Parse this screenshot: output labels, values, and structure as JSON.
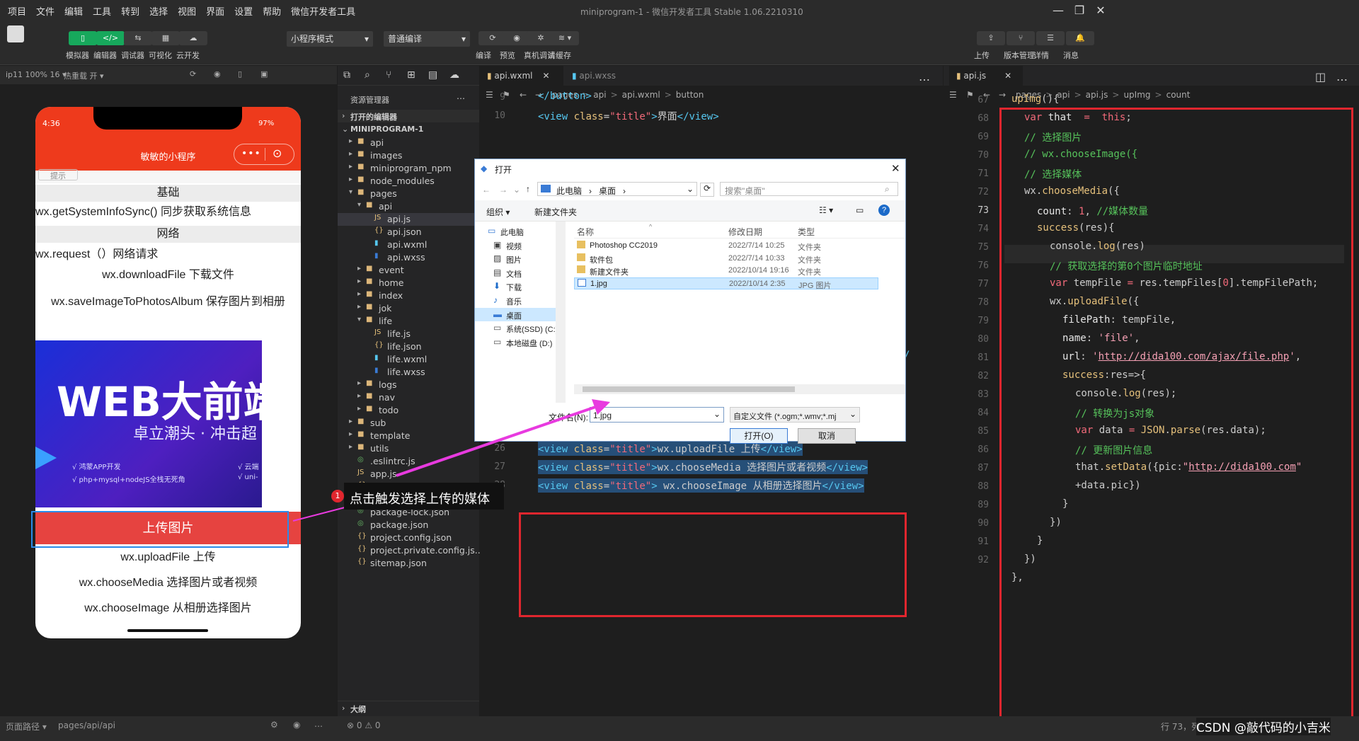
{
  "menubar": {
    "items": [
      "项目",
      "文件",
      "编辑",
      "工具",
      "转到",
      "选择",
      "视图",
      "界面",
      "设置",
      "帮助",
      "微信开发者工具"
    ],
    "window_title": "miniprogram-1 - 微信开发者工具 Stable 1.06.2210310"
  },
  "toolbar": {
    "left_buttons": [
      {
        "label": "模拟器",
        "icon": "phone-icon"
      },
      {
        "label": "编辑器",
        "icon": "code-icon"
      },
      {
        "label": "调试器",
        "icon": "debug-icon"
      },
      {
        "label": "可视化",
        "icon": "layout-icon"
      },
      {
        "label": "云开发",
        "icon": "cloud-icon"
      }
    ],
    "mode_select": "小程序模式",
    "compile_select": "普通编译",
    "mid_buttons": [
      {
        "label": "编译",
        "icon": "refresh-icon"
      },
      {
        "label": "预览",
        "icon": "eye-icon"
      },
      {
        "label": "真机调试",
        "icon": "bug-icon"
      },
      {
        "label": "清缓存",
        "icon": "layers-icon"
      }
    ],
    "right_buttons": [
      {
        "label": "上传",
        "icon": "upload-icon"
      },
      {
        "label": "版本管理",
        "icon": "branch-icon"
      },
      {
        "label": "详情",
        "icon": "menu-icon"
      },
      {
        "label": "消息",
        "icon": "bell-icon"
      }
    ]
  },
  "simulator": {
    "device": "ip11 100% 16 ▾",
    "hotreload": "热重载 开 ▾",
    "status_time": "4:36",
    "battery": "97%",
    "nav_title": "敏敏的小程序",
    "partial_button": "提示",
    "rows": [
      "基础",
      "wx.getSystemInfoSync() 同步获取系统信息",
      "网络",
      "wx.request（）网络请求",
      "wx.downloadFile 下载文件",
      "wx.saveImageToPhotosAlbum 保存图片到相册"
    ],
    "banner": {
      "big": "WEB大前端",
      "sub": "卓立潮头 · 冲击超",
      "b1": "√ 鸿蒙APP开发",
      "b2": "√ php+mysql+nodeJS全栈无死角",
      "b3": "√ 云端",
      "b4": "√ uni-"
    },
    "upload_button": "上传图片",
    "rows2": [
      "wx.uploadFile 上传",
      "wx.chooseMedia 选择图片或者视频",
      "wx.chooseImage 从相册选择图片"
    ]
  },
  "explorer": {
    "title": "资源管理器",
    "open_editors": "打开的编辑器",
    "project": "MINIPROGRAM-1",
    "tree": [
      {
        "name": "api",
        "type": "folder",
        "level": 1
      },
      {
        "name": "images",
        "type": "folder",
        "level": 1
      },
      {
        "name": "miniprogram_npm",
        "type": "folder",
        "level": 1
      },
      {
        "name": "node_modules",
        "type": "folder",
        "level": 1
      },
      {
        "name": "pages",
        "type": "folder-open",
        "level": 1
      },
      {
        "name": "api",
        "type": "folder-open",
        "level": 2
      },
      {
        "name": "api.js",
        "type": "js",
        "level": 3,
        "selected": true
      },
      {
        "name": "api.json",
        "type": "json",
        "level": 3
      },
      {
        "name": "api.wxml",
        "type": "wxml",
        "level": 3
      },
      {
        "name": "api.wxss",
        "type": "wxss",
        "level": 3
      },
      {
        "name": "event",
        "type": "folder",
        "level": 2
      },
      {
        "name": "home",
        "type": "folder",
        "level": 2
      },
      {
        "name": "index",
        "type": "folder",
        "level": 2
      },
      {
        "name": "jok",
        "type": "folder",
        "level": 2
      },
      {
        "name": "life",
        "type": "folder-open",
        "level": 2
      },
      {
        "name": "life.js",
        "type": "js",
        "level": 3
      },
      {
        "name": "life.json",
        "type": "json",
        "level": 3
      },
      {
        "name": "life.wxml",
        "type": "wxml",
        "level": 3
      },
      {
        "name": "life.wxss",
        "type": "wxss",
        "level": 3
      },
      {
        "name": "logs",
        "type": "folder",
        "level": 2
      },
      {
        "name": "nav",
        "type": "folder",
        "level": 2
      },
      {
        "name": "todo",
        "type": "folder",
        "level": 2
      },
      {
        "name": "sub",
        "type": "folder",
        "level": 1
      },
      {
        "name": "template",
        "type": "folder",
        "level": 1
      },
      {
        "name": "utils",
        "type": "folder",
        "level": 1
      },
      {
        "name": ".eslintrc.js",
        "type": "cfg",
        "level": 1
      },
      {
        "name": "app.js",
        "type": "js",
        "level": 1
      },
      {
        "name": "app.json",
        "type": "json",
        "level": 1
      },
      {
        "name": "app.wxss",
        "type": "wxss",
        "level": 1
      },
      {
        "name": "package-lock.json",
        "type": "cfg",
        "level": 1
      },
      {
        "name": "package.json",
        "type": "cfg",
        "level": 1
      },
      {
        "name": "project.config.json",
        "type": "json",
        "level": 1
      },
      {
        "name": "project.private.config.js...",
        "type": "json",
        "level": 1
      },
      {
        "name": "sitemap.json",
        "type": "json",
        "level": 1
      }
    ],
    "outline": "大纲"
  },
  "editor1": {
    "tabs": [
      "api.wxml",
      "api.wxss"
    ],
    "breadcrumb": [
      "pages",
      ">",
      "api",
      ">",
      "api.wxml",
      ">",
      "button"
    ],
    "lines": [
      9,
      10,
      24,
      25,
      26,
      27,
      28
    ]
  },
  "editor2": {
    "tab": "api.js",
    "breadcrumb": [
      "pages",
      ">",
      "api",
      ">",
      "api.js",
      ">",
      "upImg",
      ">",
      "count"
    ],
    "lines": [
      67,
      68,
      69,
      70,
      71,
      72,
      73,
      74,
      75,
      76,
      77,
      78,
      79,
      80,
      81,
      82,
      83,
      84,
      85,
      86,
      87,
      88,
      89,
      90,
      91,
      92
    ],
    "url1": "http://dida100.com/ajax/file.php",
    "url2": "http://dida100.com"
  },
  "dialog": {
    "title": "打开",
    "path": [
      "此电脑",
      "›",
      "桌面",
      "›"
    ],
    "search_placeholder": "搜索\"桌面\"",
    "organize": "组织 ▾",
    "new_folder": "新建文件夹",
    "col_name": "名称",
    "col_date": "修改日期",
    "col_type": "类型",
    "sidebar": [
      {
        "name": "此电脑",
        "icon": "pc-icon"
      },
      {
        "name": "视频",
        "icon": "video-icon"
      },
      {
        "name": "图片",
        "icon": "picture-icon"
      },
      {
        "name": "文档",
        "icon": "document-icon"
      },
      {
        "name": "下载",
        "icon": "download-icon"
      },
      {
        "name": "音乐",
        "icon": "music-icon"
      },
      {
        "name": "桌面",
        "icon": "desktop-icon"
      },
      {
        "name": "系统(SSD) (C:)",
        "icon": "drive-icon"
      },
      {
        "name": "本地磁盘 (D:)",
        "icon": "drive-icon"
      }
    ],
    "files": [
      {
        "name": "Photoshop CC2019",
        "date": "2022/7/14 10:25",
        "type": "文件夹"
      },
      {
        "name": "软件包",
        "date": "2022/7/14 10:33",
        "type": "文件夹"
      },
      {
        "name": "新建文件夹",
        "date": "2022/10/14 19:16",
        "type": "文件夹"
      },
      {
        "name": "1.jpg",
        "date": "2022/10/14 2:35",
        "type": "JPG 图片"
      }
    ],
    "filename_label": "文件名(N):",
    "filename_value": "1.jpg",
    "filter": "自定义文件 (*.ogm;*.wmv;*.mj",
    "open_button": "打开(O)",
    "cancel_button": "取消"
  },
  "annotation": {
    "badge": "1",
    "text": "点击触发选择上传的媒体"
  },
  "statusbar": {
    "path_label": "页面路径 ▾",
    "path": "pages/api/api",
    "problems": "⊗ 0 ⚠ 0",
    "position": "行 73，列",
    "watermark": "CSDN @敲代码的小吉米"
  },
  "colors": {
    "accent_red": "#e0262e",
    "nav_red": "#ee3a1c",
    "green": "#17a85c",
    "magenta_arrow": "#e83adf"
  }
}
